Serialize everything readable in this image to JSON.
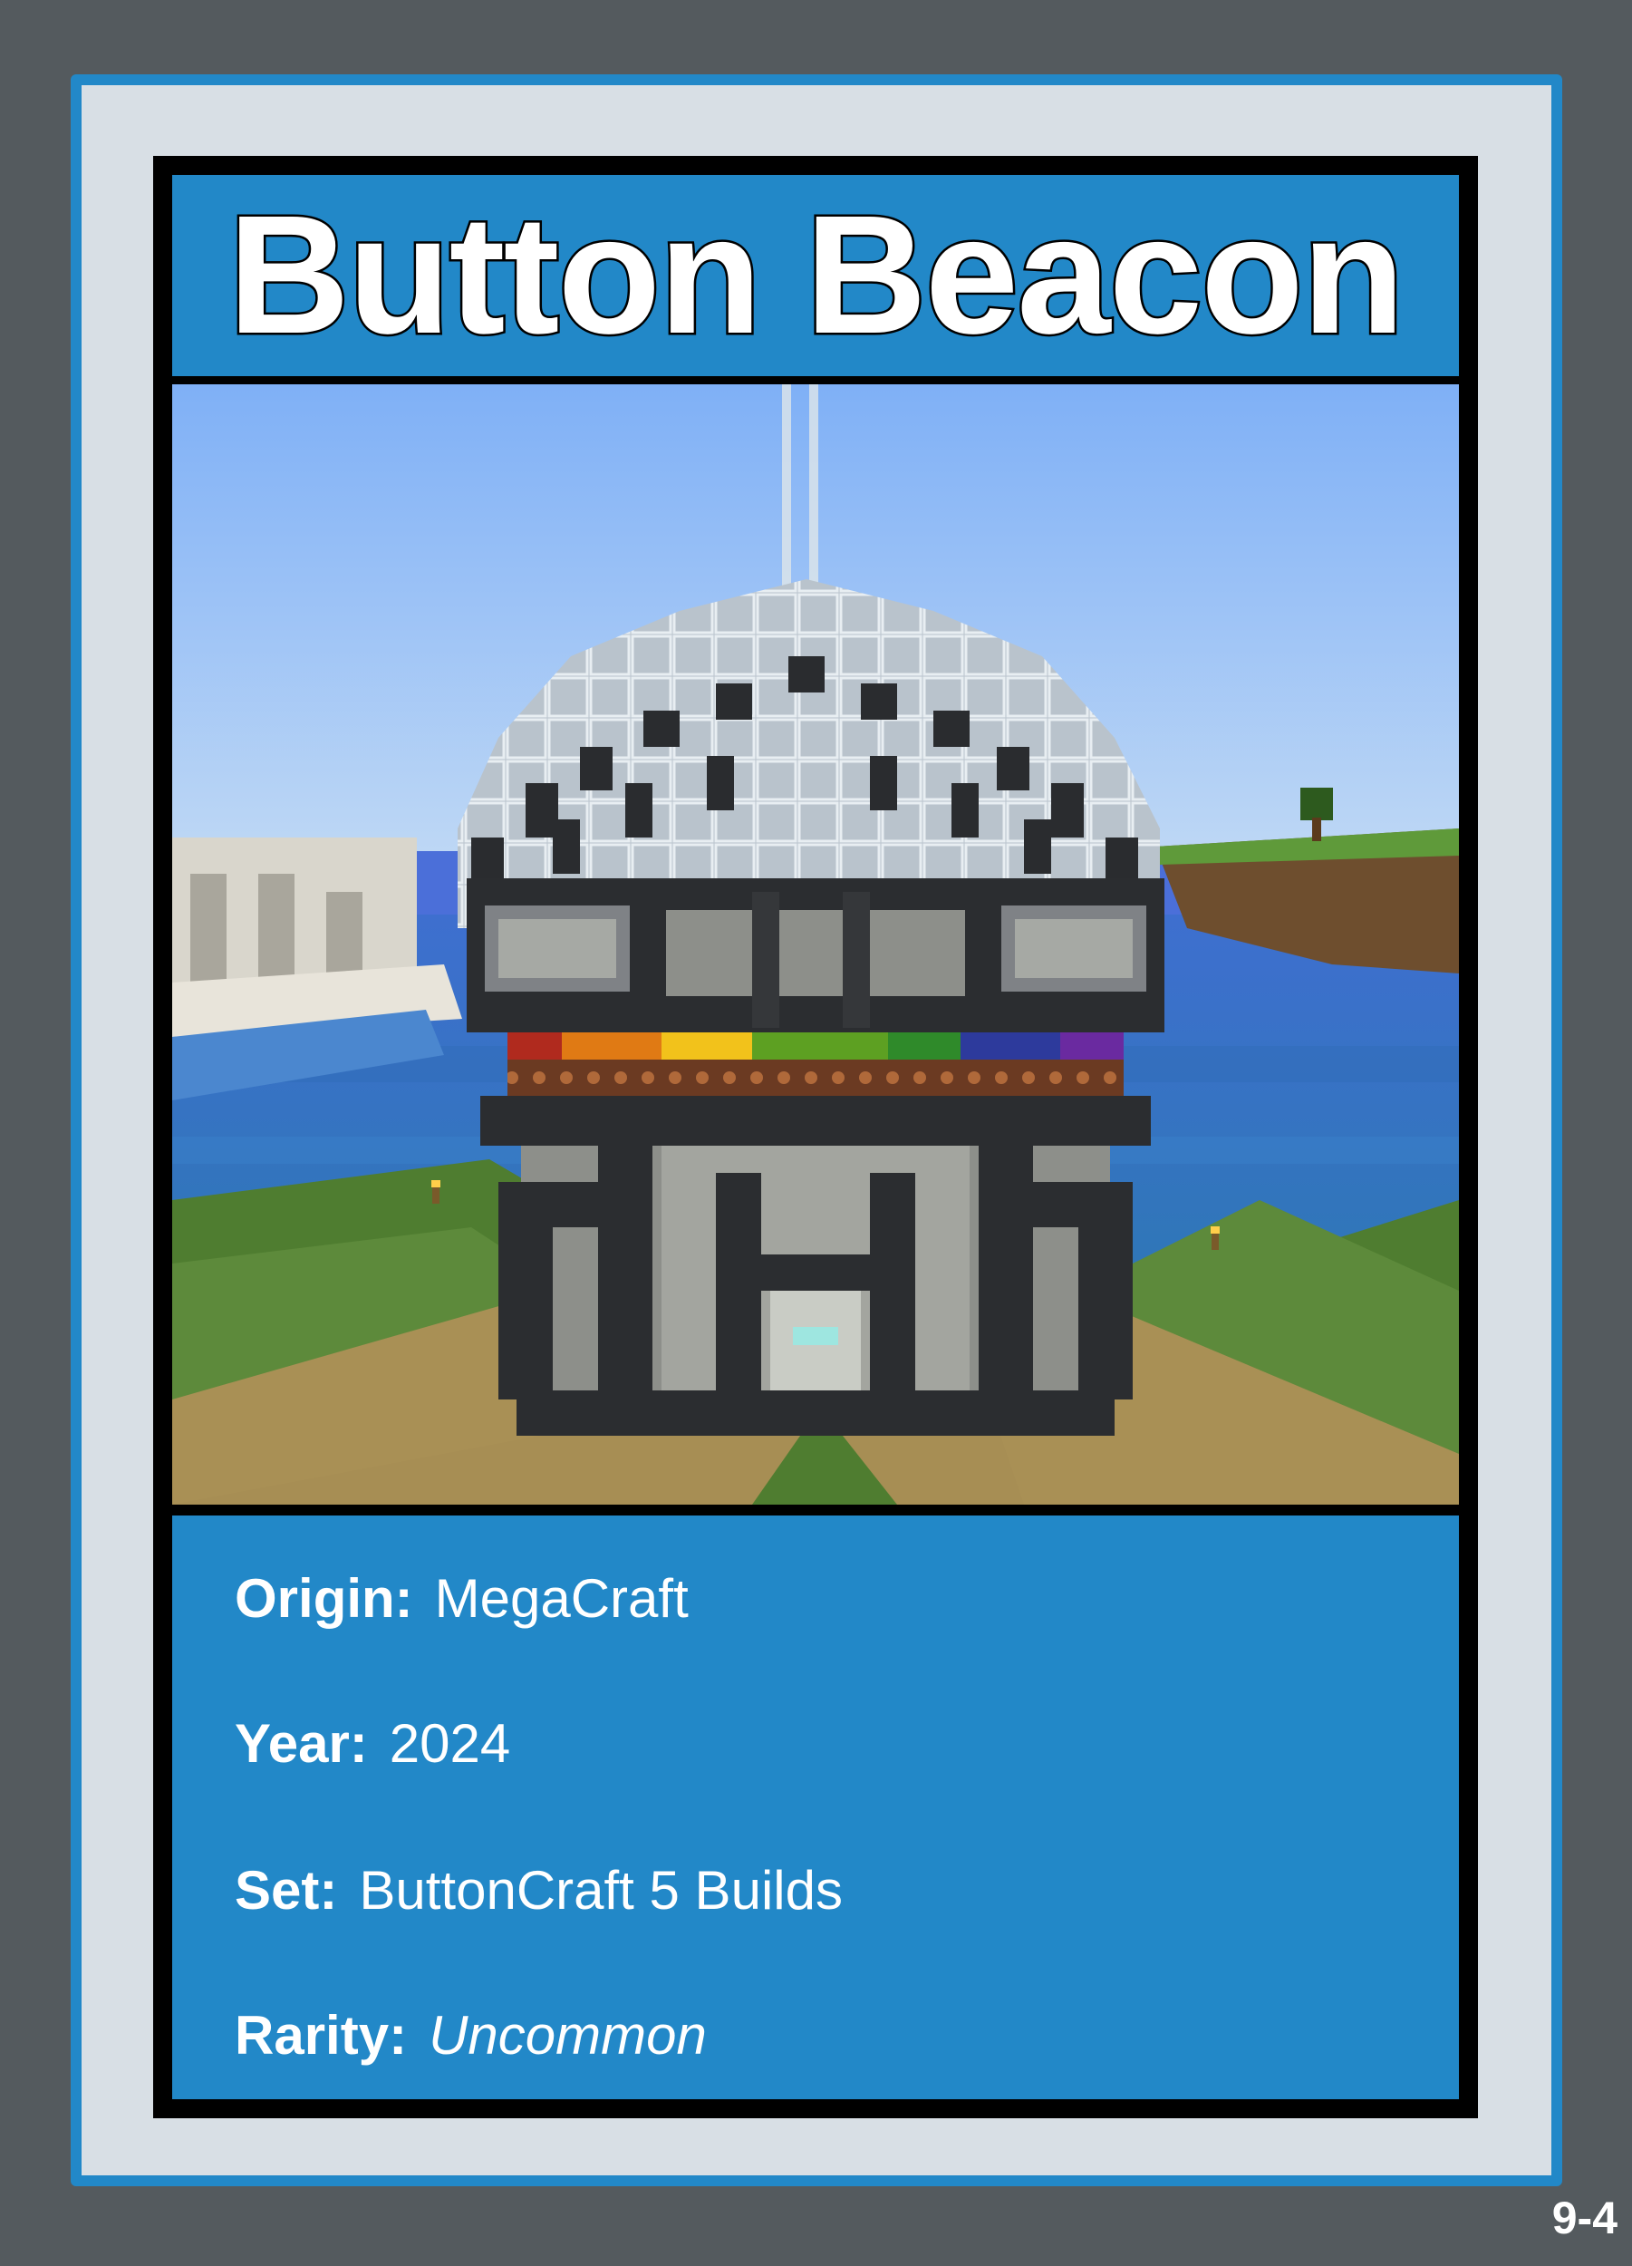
{
  "card": {
    "title": "Button Beacon",
    "number": "9-4",
    "image_alt": "Minecraft build: dark stone tower with glass dome, rainbow wool band and redstone lamps",
    "fields": [
      {
        "label": "Origin:",
        "value": "MegaCraft",
        "italic": false
      },
      {
        "label": "Year:",
        "value": "2024",
        "italic": false
      },
      {
        "label": "Set:",
        "value": "ButtonCraft 5 Builds",
        "italic": false
      },
      {
        "label": "Rarity:",
        "value": "Uncommon",
        "italic": true
      }
    ]
  },
  "colors": {
    "background": "#545a5e",
    "card_blue": "#2288c8",
    "card_inner": "#d8dfe5",
    "frame": "#000000",
    "text": "#ffffff"
  }
}
